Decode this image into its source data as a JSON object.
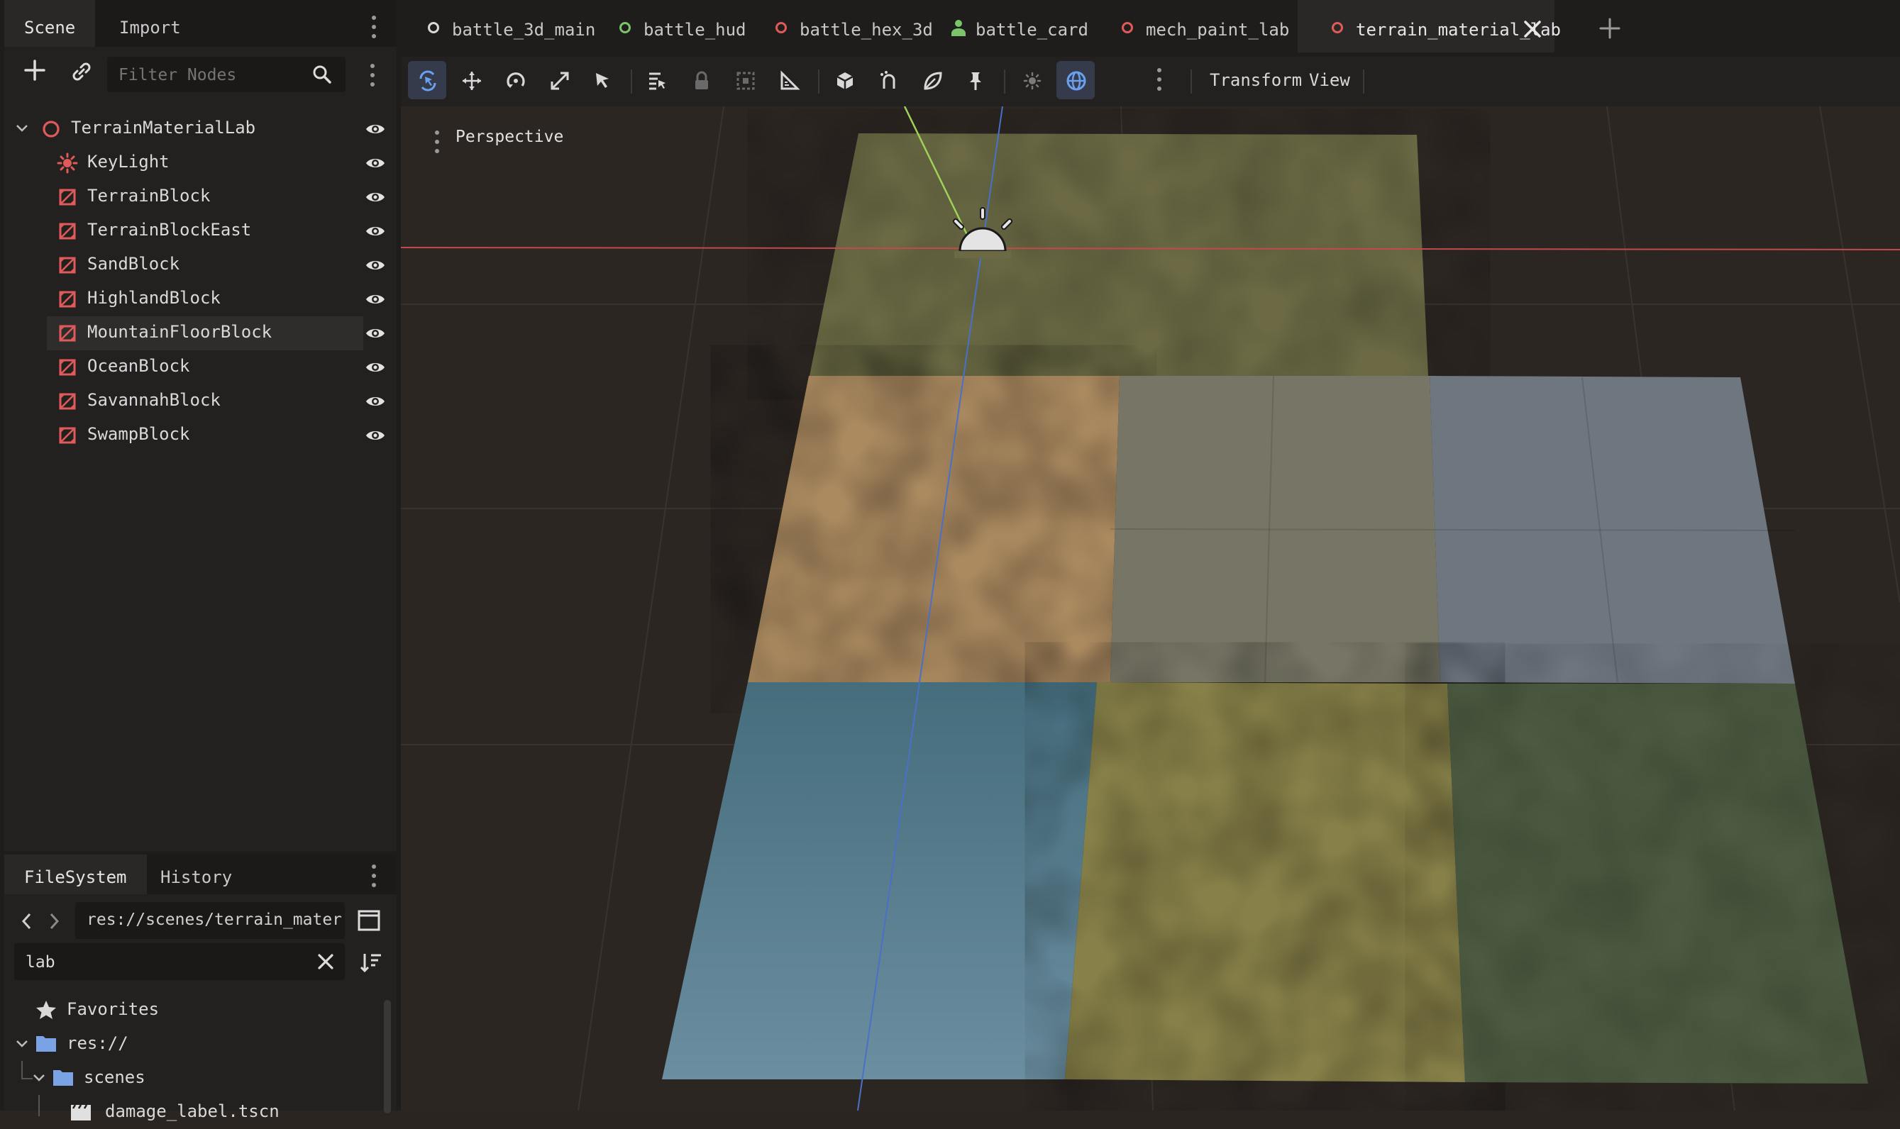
{
  "scene_dock": {
    "tabs": [
      "Scene",
      "Import"
    ],
    "filter_placeholder": "Filter Nodes",
    "tree": [
      {
        "label": "TerrainMaterialLab",
        "type": "root"
      },
      {
        "label": "KeyLight",
        "type": "light"
      },
      {
        "label": "TerrainBlock",
        "type": "mesh"
      },
      {
        "label": "TerrainBlockEast",
        "type": "mesh"
      },
      {
        "label": "SandBlock",
        "type": "mesh"
      },
      {
        "label": "HighlandBlock",
        "type": "mesh"
      },
      {
        "label": "MountainFloorBlock",
        "type": "mesh",
        "selected": true
      },
      {
        "label": "OceanBlock",
        "type": "mesh"
      },
      {
        "label": "SavannahBlock",
        "type": "mesh"
      },
      {
        "label": "SwampBlock",
        "type": "mesh"
      }
    ]
  },
  "filesystem_dock": {
    "tabs": [
      "FileSystem",
      "History"
    ],
    "path": "res://scenes/terrain_materia",
    "search_value": "lab",
    "items": [
      {
        "label": "Favorites",
        "icon": "star-icon"
      },
      {
        "label": "res://",
        "icon": "folder-icon"
      },
      {
        "label": "scenes",
        "icon": "folder-icon"
      },
      {
        "label": "damage_label.tscn",
        "icon": "scene-file-icon"
      }
    ]
  },
  "editor_tabs": [
    {
      "label": "battle_3d_main",
      "color": "#d8d8d8"
    },
    {
      "label": "battle_hud",
      "color": "#7ac46a"
    },
    {
      "label": "battle_hex_3d",
      "color": "#e05a5a"
    },
    {
      "label": "battle_card",
      "color": "#7ac46a"
    },
    {
      "label": "mech_paint_lab",
      "color": "#e05a5a"
    },
    {
      "label": "terrain_material_lab",
      "color": "#e05a5a",
      "active": true
    }
  ],
  "toolbar": {
    "transform_label": "Transform",
    "view_label": "View"
  },
  "viewport": {
    "perspective_label": "Perspective"
  },
  "colors": {
    "accent": "#4f8fe8",
    "node_red": "#e05a5a",
    "sand": "#b08e63",
    "ocean": "#4a6f80",
    "savannah": "#8a8148",
    "swamp": "#4c5c40",
    "highland": "#7a7868",
    "mountain": "#707884",
    "terrain_top": "#6c6a44"
  }
}
